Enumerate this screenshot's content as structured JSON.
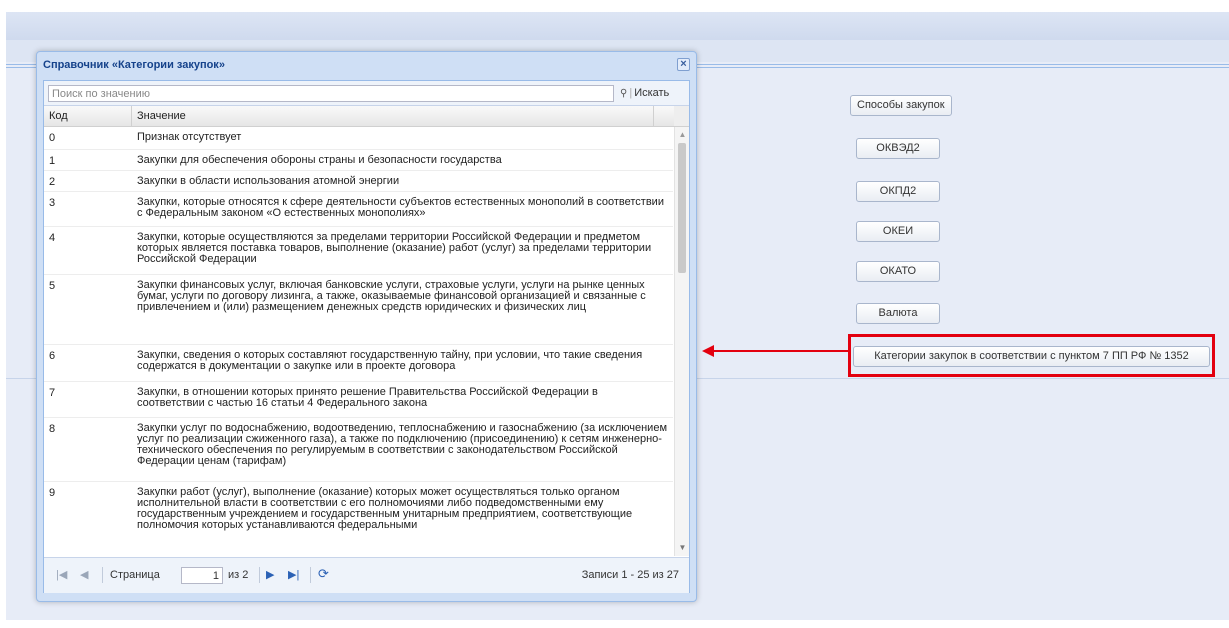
{
  "colors": {
    "accent_title": "#15428b",
    "highlight_border": "#e3000f",
    "panel_border": "#99bbe8"
  },
  "side_buttons": [
    {
      "label": "Способы закупок"
    },
    {
      "label": "ОКВЭД2"
    },
    {
      "label": "ОКПД2"
    },
    {
      "label": "ОКЕИ"
    },
    {
      "label": "ОКАТО"
    },
    {
      "label": "Валюта"
    },
    {
      "label": "Категории закупок в соответствии с пунктом 7 ПП РФ № 1352"
    }
  ],
  "dialog": {
    "title": "Справочник «Категории закупок»",
    "close_icon": "close-icon",
    "search": {
      "placeholder": "Поиск по значению",
      "button_label": "Искать",
      "icon": "binoculars-icon"
    },
    "columns": {
      "code": "Код",
      "value": "Значение"
    },
    "rows": [
      {
        "code": "0",
        "value": "Признак отсутствует"
      },
      {
        "code": "1",
        "value": "Закупки для обеспечения обороны страны и безопасности государства"
      },
      {
        "code": "2",
        "value": "Закупки в области использования атомной энергии"
      },
      {
        "code": "3",
        "value": "Закупки, которые относятся к сфере деятельности субъектов естественных монополий в соответствии с Федеральным законом «О естественных монополиях»"
      },
      {
        "code": "4",
        "value": "Закупки, которые осуществляются за пределами территории Российской Федерации и предметом которых является поставка товаров, выполнение (оказание) работ (услуг) за пределами территории Российской Федерации"
      },
      {
        "code": "5",
        "value": "Закупки финансовых услуг, включая банковские услуги, страховые услуги, услуги на рынке ценных бумаг, услуги по договору лизинга, а также, оказываемые финансовой организацией и связанные с привлечением и (или) размещением денежных средств юридических и физических лиц"
      },
      {
        "code": "6",
        "value": "Закупки, сведения о которых составляют государственную тайну, при условии, что такие сведения содержатся в документации о закупке или в проекте договора"
      },
      {
        "code": "7",
        "value": "Закупки, в отношении которых принято решение Правительства Российской Федерации в соответствии с частью 16 статьи 4 Федерального закона"
      },
      {
        "code": "8",
        "value": "Закупки услуг по водоснабжению, водоотведению, теплоснабжению и газоснабжению (за исключением услуг по реализации сжиженного газа), а также по подключению (присоединению) к сетям инженерно-технического обеспечения по регулируемым в соответствии с законодательством Российской Федерации ценам (тарифам)"
      },
      {
        "code": "9",
        "value": "Закупки работ (услуг), выполнение (оказание) которых может осуществляться только органом исполнительной власти в соответствии с его полномочиями либо подведомственными ему государственным учреждением и государственным унитарным предприятием, соответствующие полномочия которых устанавливаются федеральными"
      }
    ],
    "paging": {
      "page_label": "Страница",
      "page_value": "1",
      "of_label": "из 2",
      "records": "Записи 1 - 25 из 27",
      "icons": [
        "first-page-icon",
        "prev-page-icon",
        "next-page-icon",
        "last-page-icon",
        "refresh-icon"
      ]
    }
  }
}
